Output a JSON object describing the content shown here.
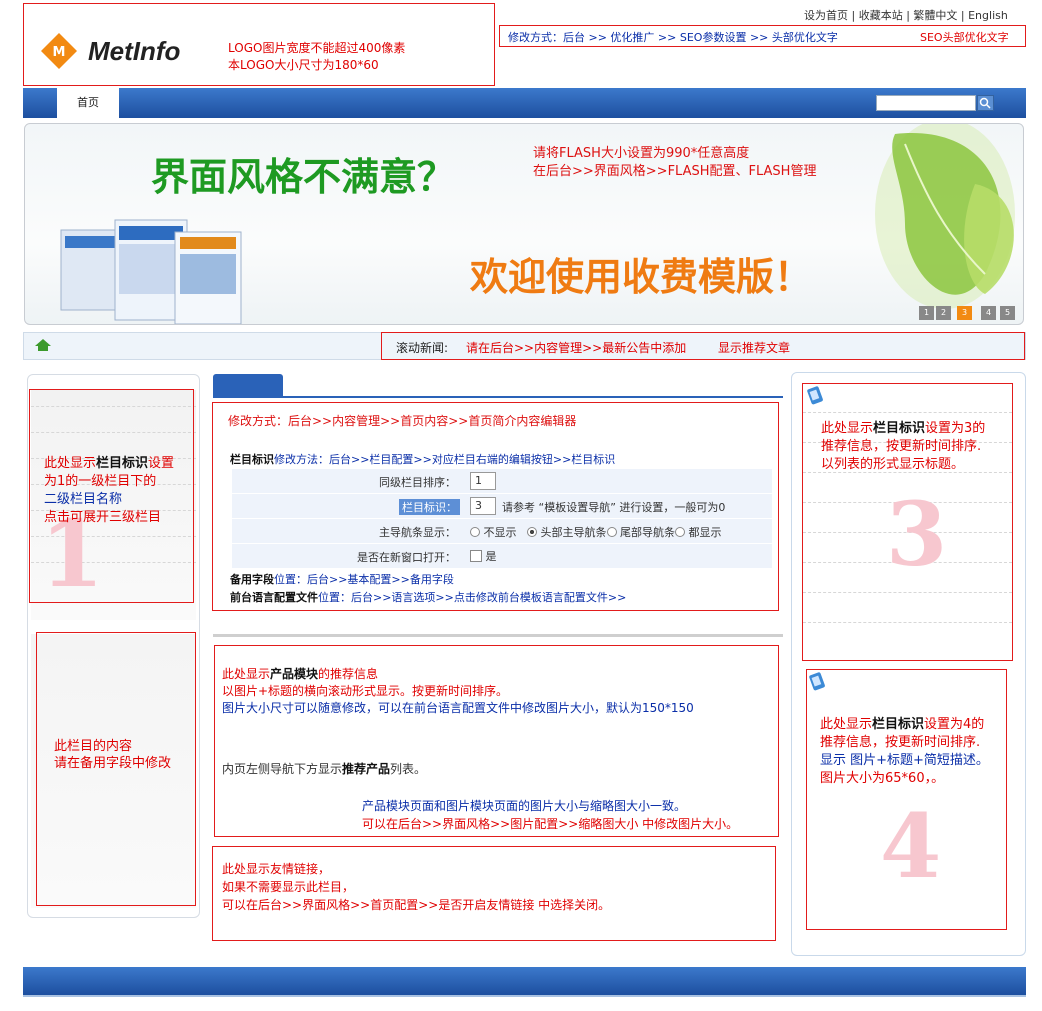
{
  "top_links": [
    "设为首页",
    "收藏本站",
    "繁體中文",
    "English"
  ],
  "logo": {
    "text": "MetInfo",
    "note1": "LOGO图片宽度不能超过400像素",
    "note2": "本LOGO大小尺寸为180*60"
  },
  "seo": {
    "path": "修改方式：后台 >> 优化推广 >> SEO参数设置 >> 头部优化文字",
    "label": "SEO头部优化文字"
  },
  "nav": {
    "home": "首页"
  },
  "banner": {
    "headline": "界面风格不满意？",
    "note1": "请将FLASH大小设置为990*任意高度",
    "note2": "在后台>>界面风格>>FLASH配置、FLASH管理",
    "welcome": "欢迎使用收费模版！",
    "slides": [
      "1",
      "2",
      "3",
      "4",
      "5"
    ]
  },
  "news": {
    "label": "滚动新闻:",
    "text": "请在后台>>内容管理>>最新公告中添加",
    "recommend": "显示推荐文章"
  },
  "left1": {
    "line1": "此处显示",
    "line1b": "栏目标识",
    "line1c": "设置",
    "line2": "为1的一级栏目下的",
    "line3": "二级栏目名称",
    "line4": "点击可展开三级栏目",
    "num": "1"
  },
  "left2": {
    "line1": "此栏目的内容",
    "line2": "请在备用字段中修改"
  },
  "intro": {
    "path": "修改方式：后台>>内容管理>>首页内容>>首页简介内容编辑器",
    "col_label": "栏目标识",
    "col_method": "修改方法：后台>>栏目配置>>对应栏目右端的编辑按钮>>栏目标识",
    "row1_label": "同级栏目排序：",
    "row1_value": "1",
    "row2_label": "栏目标识：",
    "row2_value": "3",
    "row2_hint": "请参考 “模板设置导航” 进行设置，一般可为0",
    "row3_label": "主导航条显示：",
    "row3_opts": [
      "不显示",
      "头部主导航条",
      "尾部导航条",
      "都显示"
    ],
    "row4_label": "是否在新窗口打开：",
    "row4_opt": "是",
    "spare_label": "备用字段",
    "spare_path": "位置：后台>>基本配置>>备用字段",
    "lang_label": "前台语言配置文件",
    "lang_path": "位置：后台>>语言选项>>点击修改前台模板语言配置文件>>"
  },
  "products": {
    "line1a": "此处显示",
    "line1b": "产品模块",
    "line1c": "的推荐信息",
    "line2": "以图片+标题的横向滚动形式显示。按更新时间排序。",
    "line3": "图片大小尺寸可以随意修改，可以在前台语言配置文件中修改图片大小，默认为150*150",
    "line4a": "内页左侧导航下方显示",
    "line4b": "推荐产品",
    "line4c": "列表。",
    "line5": "产品模块页面和图片模块页面的图片大小与缩略图大小一致。",
    "line6": "可以在后台>>界面风格>>图片配置>>缩略图大小  中修改图片大小。"
  },
  "links": {
    "line1": "此处显示友情链接，",
    "line2": "如果不需要显示此栏目，",
    "line3": "可以在后台>>界面风格>>首页配置>>是否开启友情链接  中选择关闭。"
  },
  "right3": {
    "line1a": "此处显示",
    "line1b": "栏目标识",
    "line1c": "设置为3的",
    "line2": "推荐信息，按更新时间排序.",
    "line3": "以列表的形式显示标题。",
    "num": "3"
  },
  "right4": {
    "line1a": "此处显示",
    "line1b": "栏目标识",
    "line1c": "设置为4的",
    "line2": "推荐信息，按更新时间排序.",
    "line3": "显示 图片+标题+简短描述。",
    "line4": "图片大小为65*60，。",
    "num": "4"
  },
  "colors": {
    "nav_blue": "#2a62b8",
    "red": "#e00000",
    "blue_text": "#0a2ea8",
    "big_num": "#f7c7cf"
  }
}
